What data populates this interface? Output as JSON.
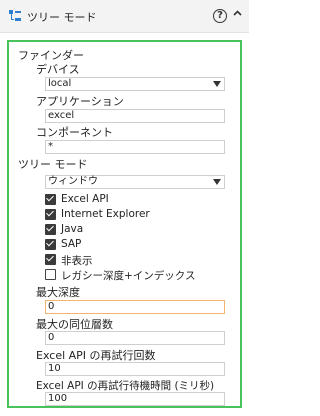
{
  "header": {
    "title": "ツリー モード",
    "help_icon_text": "?"
  },
  "finder": {
    "section_label": "ファインダー",
    "device_label": "デバイス",
    "device_value": "local",
    "application_label": "アプリケーション",
    "application_value": "excel",
    "component_label": "コンポーネント",
    "component_value": "*"
  },
  "tree_mode": {
    "section_label": "ツリー モード",
    "mode_value": "ウィンドウ",
    "options": [
      {
        "label": "Excel API",
        "checked": true
      },
      {
        "label": "Internet Explorer",
        "checked": true
      },
      {
        "label": "Java",
        "checked": true
      },
      {
        "label": "SAP",
        "checked": true
      },
      {
        "label": "非表示",
        "checked": true
      },
      {
        "label": "レガシー深度+インデックス",
        "checked": false
      }
    ],
    "max_depth_label": "最大深度",
    "max_depth_value": "0",
    "max_siblings_label": "最大の同位層数",
    "max_siblings_value": "0",
    "retry_count_label": "Excel API の再試行回数",
    "retry_count_value": "10",
    "retry_wait_label": "Excel API の再試行待機時間 (ミリ秒)",
    "retry_wait_value": "100"
  },
  "colors": {
    "panel_border": "#49c25a",
    "header_bg": "#f3f3f3",
    "focus_border": "#f4b36f"
  }
}
